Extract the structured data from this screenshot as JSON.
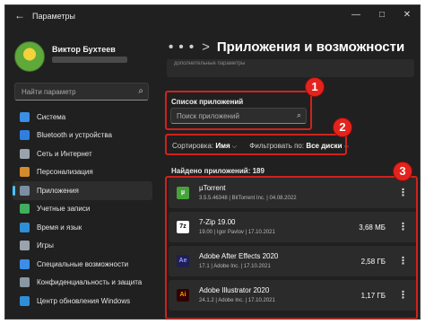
{
  "window": {
    "title": "Параметры",
    "back_icon": "arrow-left-icon",
    "controls": [
      "—",
      "□",
      "✕"
    ]
  },
  "sidebar": {
    "user_name": "Виктор Бухтеев",
    "search_placeholder": "Найти параметр",
    "items": [
      {
        "label": "Система",
        "icon": "monitor-icon",
        "color": "#3a8ee6"
      },
      {
        "label": "Bluetooth и устройства",
        "icon": "bluetooth-icon",
        "color": "#2f7fe0"
      },
      {
        "label": "Сеть и Интернет",
        "icon": "network-icon",
        "color": "#9aa3ad"
      },
      {
        "label": "Персонализация",
        "icon": "brush-icon",
        "color": "#d38b2c"
      },
      {
        "label": "Приложения",
        "icon": "apps-icon",
        "color": "#7d8ea3",
        "active": true
      },
      {
        "label": "Учетные записи",
        "icon": "person-icon",
        "color": "#3fae5d"
      },
      {
        "label": "Время и язык",
        "icon": "globe-icon",
        "color": "#2e8fd8"
      },
      {
        "label": "Игры",
        "icon": "gamepad-icon",
        "color": "#9aa3ad"
      },
      {
        "label": "Специальные возможности",
        "icon": "accessibility-icon",
        "color": "#3a8ee6"
      },
      {
        "label": "Конфиденциальность и защита",
        "icon": "shield-icon",
        "color": "#8a96a3"
      },
      {
        "label": "Центр обновления Windows",
        "icon": "update-icon",
        "color": "#2e8fd8"
      }
    ]
  },
  "main": {
    "breadcrumb_dots": "• • •",
    "breadcrumb_sep": ">",
    "title": "Приложения и возможности",
    "top_card_text": "дополнительные параметры",
    "apps_list_label": "Список приложений",
    "apps_search_placeholder": "Поиск приложений",
    "sort_label": "Сортировка:",
    "sort_value": "Имя",
    "filter_label": "Фильтровать по:",
    "filter_value": "Все диски",
    "found_text": "Найдено приложений: 189",
    "apps": [
      {
        "name": "µTorrent",
        "meta": "3.5.5.46348  |  BitTorrent Inc.  |  04.08.2022",
        "size": "",
        "icon": "utorrent-icon",
        "icon_text": "µ",
        "icon_bg": "#46a23b",
        "icon_fg": "#ffffff"
      },
      {
        "name": "7-Zip 19.00",
        "meta": "19.00  |  Igor Pavlov  |  17.10.2021",
        "size": "3,68 МБ",
        "icon": "7zip-icon",
        "icon_text": "7z",
        "icon_bg": "#ffffff",
        "icon_fg": "#000000"
      },
      {
        "name": "Adobe After Effects 2020",
        "meta": "17.1  |  Adobe Inc.  |  17.10.2021",
        "size": "2,58 ГБ",
        "icon": "after-effects-icon",
        "icon_text": "Ae",
        "icon_bg": "#1f1f55",
        "icon_fg": "#9999ff"
      },
      {
        "name": "Adobe Illustrator 2020",
        "meta": "24.1.2  |  Adobe Inc.  |  17.10.2021",
        "size": "1,17 ГБ",
        "icon": "illustrator-icon",
        "icon_text": "Ai",
        "icon_bg": "#330000",
        "icon_fg": "#ff9a00"
      }
    ]
  },
  "annotations": {
    "badges": [
      "1",
      "2",
      "3"
    ],
    "color": "#d0221c"
  }
}
